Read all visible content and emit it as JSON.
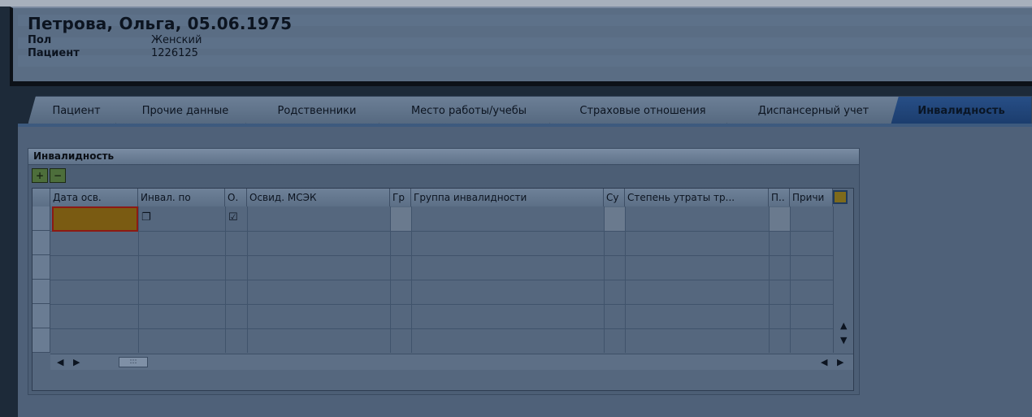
{
  "header": {
    "title": "Петрова, Ольга, 05.06.1975",
    "fields": [
      {
        "label": "Пол",
        "value": "Женский"
      },
      {
        "label": "Пациент",
        "value": "1226125"
      }
    ]
  },
  "tabs": [
    {
      "label": "Пациент",
      "active": false
    },
    {
      "label": "Прочие данные",
      "active": false
    },
    {
      "label": "Родственники",
      "active": false
    },
    {
      "label": "Место работы/учебы",
      "active": false
    },
    {
      "label": "Страховые отношения",
      "active": false
    },
    {
      "label": "Диспансерный учет",
      "active": false
    },
    {
      "label": "Инвалидность",
      "active": true
    }
  ],
  "group": {
    "title": "Инвалидность",
    "toolbar": [
      {
        "icon": "add-row-icon"
      },
      {
        "icon": "delete-row-icon"
      }
    ]
  },
  "table": {
    "columns": [
      "Дата осв.",
      "Инвал. по",
      "О.",
      "Освид. МСЭК",
      "Гр",
      "Группа инвалидности",
      "Су",
      "Степень утраты тр...",
      "П..",
      "Причи"
    ],
    "row_count": 6,
    "first_row": {
      "date_value": "",
      "invalid_po_icon": "square-icon",
      "o_checkbox": "☑"
    }
  },
  "colors": {
    "active_tab": "#274e86",
    "focus_cell": "#7a5b12",
    "focus_border": "#8c1a14"
  }
}
